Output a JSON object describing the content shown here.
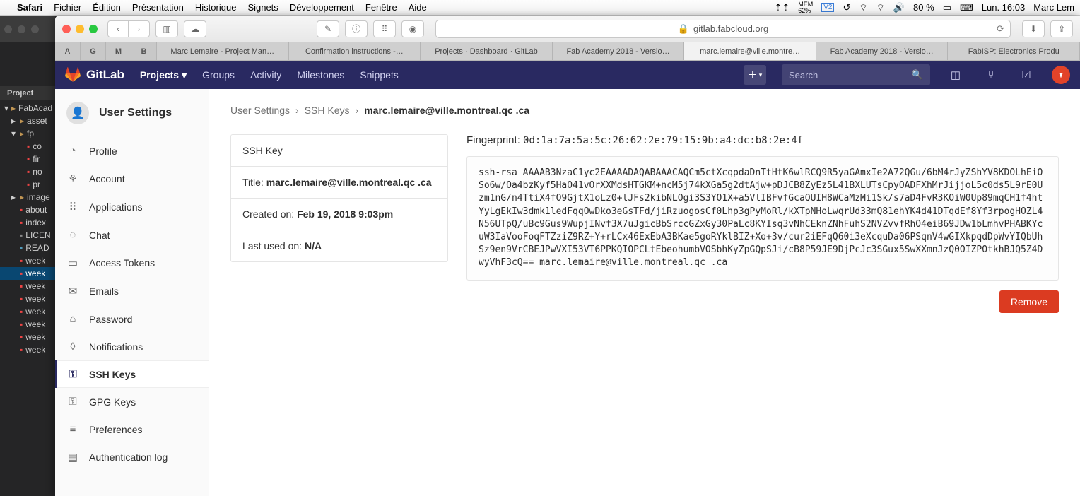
{
  "mac": {
    "app": "Safari",
    "menus": [
      "Fichier",
      "Édition",
      "Présentation",
      "Historique",
      "Signets",
      "Développement",
      "Fenêtre",
      "Aide"
    ],
    "mem_label": "MEM",
    "mem_pct": "62%",
    "battery": "80 %",
    "clock": "Lun. 16:03",
    "user": "Marc Lem"
  },
  "editor": {
    "panel": "Project",
    "tree": [
      {
        "d": 0,
        "t": "fo",
        "arrow": "▾",
        "label": "FabAcad"
      },
      {
        "d": 1,
        "t": "fo",
        "arrow": "▸",
        "label": "asset"
      },
      {
        "d": 1,
        "t": "fo",
        "arrow": "▾",
        "label": "fp"
      },
      {
        "d": 2,
        "t": "fi",
        "label": "co"
      },
      {
        "d": 2,
        "t": "fi",
        "label": "fir"
      },
      {
        "d": 2,
        "t": "fi",
        "label": "no"
      },
      {
        "d": 2,
        "t": "fi",
        "label": "pr"
      },
      {
        "d": 1,
        "t": "fo",
        "arrow": "▸",
        "label": "image"
      },
      {
        "d": 1,
        "t": "fi",
        "label": "about"
      },
      {
        "d": 1,
        "t": "fi",
        "label": "index"
      },
      {
        "d": 1,
        "t": "lic",
        "label": "LICEN"
      },
      {
        "d": 1,
        "t": "md",
        "label": "READ"
      },
      {
        "d": 1,
        "t": "fi",
        "label": "week"
      },
      {
        "d": 1,
        "t": "fi",
        "label": "week",
        "sel": true
      },
      {
        "d": 1,
        "t": "fi",
        "label": "week"
      },
      {
        "d": 1,
        "t": "fi",
        "label": "week"
      },
      {
        "d": 1,
        "t": "fi",
        "label": "week"
      },
      {
        "d": 1,
        "t": "fi",
        "label": "week"
      },
      {
        "d": 1,
        "t": "fi",
        "label": "week"
      },
      {
        "d": 1,
        "t": "fi",
        "label": "week"
      }
    ]
  },
  "safari": {
    "url_host": "gitlab.fabcloud.org",
    "favs": [
      "A",
      "G",
      "M",
      "B"
    ],
    "tabs": [
      {
        "label": "Marc Lemaire - Project Man…"
      },
      {
        "label": "Confirmation instructions -…"
      },
      {
        "label": "Projects · Dashboard · GitLab"
      },
      {
        "label": "Fab Academy 2018 - Versio…"
      },
      {
        "label": "marc.lemaire@ville.montre…",
        "active": true
      },
      {
        "label": "Fab Academy 2018 - Versio…"
      },
      {
        "label": "FabISP: Electronics Produ"
      }
    ]
  },
  "gitlab": {
    "brand": "GitLab",
    "nav": {
      "projects": "Projects",
      "groups": "Groups",
      "activity": "Activity",
      "milestones": "Milestones",
      "snippets": "Snippets",
      "search_ph": "Search"
    },
    "sidebar": {
      "title": "User Settings",
      "items": [
        {
          "icon": "◔",
          "label": "Profile"
        },
        {
          "icon": "⚘",
          "label": "Account"
        },
        {
          "icon": "⠿",
          "label": "Applications"
        },
        {
          "icon": "◌",
          "label": "Chat"
        },
        {
          "icon": "▭",
          "label": "Access Tokens"
        },
        {
          "icon": "✉",
          "label": "Emails"
        },
        {
          "icon": "⌂",
          "label": "Password"
        },
        {
          "icon": "◊",
          "label": "Notifications"
        },
        {
          "icon": "⚿",
          "label": "SSH Keys",
          "active": true
        },
        {
          "icon": "⚿",
          "label": "GPG Keys"
        },
        {
          "icon": "≡",
          "label": "Preferences"
        },
        {
          "icon": "▤",
          "label": "Authentication log"
        }
      ]
    },
    "breadcrumb": {
      "a": "User Settings",
      "b": "SSH Keys",
      "c": "marc.lemaire@ville.montreal.qc .ca"
    },
    "card": {
      "heading": "SSH Key",
      "title_lbl": "Title: ",
      "title_val": "marc.lemaire@ville.montreal.qc .ca",
      "created_lbl": "Created on: ",
      "created_val": "Feb 19, 2018 9:03pm",
      "last_lbl": "Last used on: ",
      "last_val": "N/A"
    },
    "fingerprint_lbl": "Fingerprint:",
    "fingerprint": "0d:1a:7a:5a:5c:26:62:2e:79:15:9b:a4:dc:b8:2e:4f",
    "key": "ssh-rsa AAAAB3NzaC1yc2EAAAADAQABAAACAQCm5ctXcqpdaDnTtHtK6wlRCQ9R5yaGAmxIe2A72QGu/6bM4rJyZShYV8KDOLhEiOSo6w/Oa4bzKyf5HaO41vOrXXMdsHTGKM+ncM5j74kXGa5g2dtAjw+pDJCB8ZyEz5L41BXLUTsCpyOADFXhMrJijjoL5c0ds5L9rE0Uzm1nG/n4TtiX4fO9GjtX1oLz0+lJFs2kibNLOgi3S3YO1X+a5VlIBFvfGcaQUIH8WCaMzMi1Sk/s7aD4FvR3KOiW0Up89mqCH1f4htYyLgEkIw3dmk1ledFqqOwDko3eGsTFd/jiRzuogosСf0Lhp3gPyMoRl/kXTpNHoLwqrUd33mQ81ehYK4d41DTqdEf8Yf3rpogHOZL4N56UTpQ/uBc9Gus9WupjINvf3X7uJgicBbSrccGZxGy30PaLc8KYIsq3vNhCEknZNhFuhS2NVZvvfRhO4eiB69JDw1bLmhvPHABKYcuW3IaVooFoqFTZziZ9RZ+Y+rLCx46ExEbA3BKae5goRYklBIZ+Xo+3v/cur2iEFqQ60i3eXcquDa06PSqnV4wGIXkpqdDpWvYIQbUhSz9en9VrCBEJPwVXI53VT6PPKQIOPCLtEbeohumbVOSbhKyZpGQpSJi/cB8P59JE9DjPcJc3SGux5SwXXmnJzQ0OIZPOtkhBJQ5Z4DwyVhF3cQ== marc.lemaire@ville.montreal.qc .ca",
    "remove": "Remove"
  }
}
